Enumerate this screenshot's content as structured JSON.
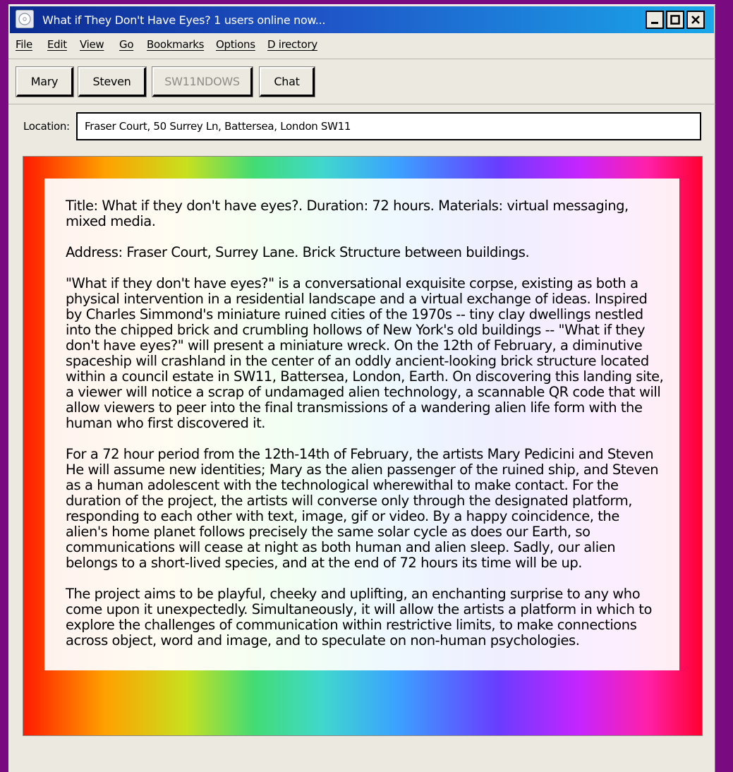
{
  "window": {
    "title": "What if They Don't Have Eyes? 1 users online now...",
    "controls": {
      "minimize": "_",
      "maximize": "□",
      "close": "×"
    }
  },
  "menu": [
    "File",
    "Edit",
    "View",
    "Go",
    "Bookmarks",
    "Options",
    "D irectory"
  ],
  "toolbar": {
    "buttons": [
      {
        "label": "Mary",
        "enabled": true
      },
      {
        "label": "Steven",
        "enabled": true
      },
      {
        "label": "SW11NDOWS",
        "enabled": false
      },
      {
        "label": "Chat",
        "enabled": true
      }
    ]
  },
  "location": {
    "label": "Location:",
    "value": "Fraser Court, 50 Surrey Ln, Battersea, London SW11"
  },
  "content": {
    "paragraphs": [
      "Title: What if they don't have eyes?. Duration: 72 hours. Materials: virtual messaging, mixed media.",
      "Address: Fraser Court, Surrey Lane. Brick Structure between buildings.",
      "\"What if they don't have eyes?\" is a conversational exquisite corpse, existing as both a physical intervention in a residential landscape and a virtual exchange of ideas. Inspired by Charles Simmond's miniature ruined cities of the 1970s -- tiny clay dwellings nestled into the chipped brick and crumbling hollows of New York's old buildings -- \"What if they don't have eyes?\" will present a miniature wreck. On the 12th of February, a diminutive spaceship will crashland in the center of an oddly ancient-looking brick structure located within a council estate in SW11, Battersea, London, Earth. On discovering this landing site, a viewer will notice a scrap of undamaged alien technology, a scannable QR code that will allow viewers to peer into the final transmissions of a wandering alien life form with the human who first discovered it.",
      "For a 72 hour period from the 12th-14th of February, the artists Mary Pedicini and Steven He will assume new identities; Mary as the alien passenger of the ruined ship, and Steven as a human adolescent with the technological wherewithal to make contact. For the duration of the project, the artists will converse only through the designated platform, responding to each other with text, image, gif or video. By a happy coincidence, the alien's home planet follows precisely the same solar cycle as does our Earth, so communications will cease at night as both human and alien sleep. Sadly, our alien belongs to a short-lived species, and at the end of 72 hours its time will be up.",
      "The project aims to be playful, cheeky and uplifting, an enchanting surprise to any who come upon it unexpectedly. Simultaneously, it will allow the artists a platform in which to explore the challenges of communication within restrictive limits, to make connections across object, word and image, and to speculate on non-human psychologies."
    ]
  }
}
